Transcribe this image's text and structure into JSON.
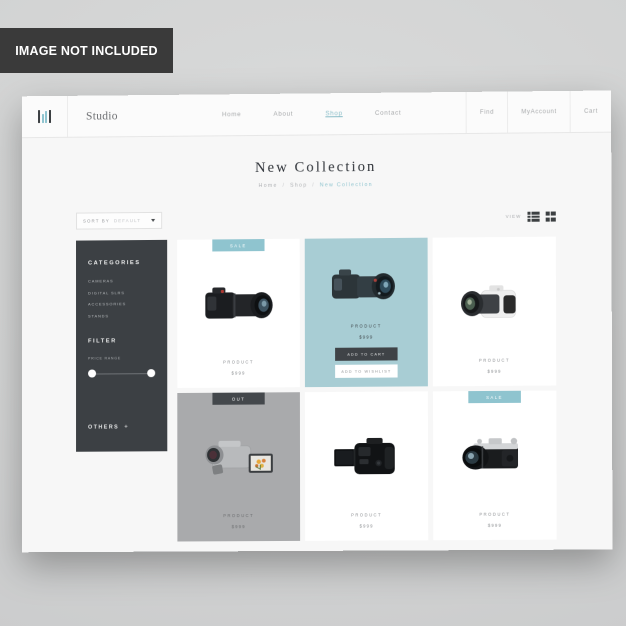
{
  "watermark": {
    "text": "IMAGE NOT INCLUDED"
  },
  "header": {
    "logo_icon": "bars-logo-icon",
    "brand": "Studio",
    "nav": [
      {
        "label": "Home",
        "active": false
      },
      {
        "label": "About",
        "active": false
      },
      {
        "label": "Shop",
        "active": true
      },
      {
        "label": "Contact",
        "active": false
      }
    ],
    "utility": [
      {
        "label": "Find"
      },
      {
        "label": "MyAccount"
      },
      {
        "label": "Cart"
      }
    ]
  },
  "page": {
    "title": "New Collection",
    "breadcrumb": {
      "first": "Home",
      "second": "Shop",
      "current": "New Collection",
      "separator": "/"
    }
  },
  "toolbar": {
    "sort_label": "SORT BY",
    "sort_value": "DEFAULT",
    "sort_caret_icon": "chevron-down-icon",
    "view_label": "VIEW",
    "list_view_icon": "list-view-icon",
    "grid_view_icon": "grid-view-icon"
  },
  "sidebar": {
    "categories_heading": "CATEGORIES",
    "categories": [
      "CAMERAS",
      "DIGITAL SLRS",
      "ACCESSORIES",
      "STANDS"
    ],
    "filter_heading": "FILTER",
    "price_range_label": "PRICE RANGE",
    "slider": {
      "min_handle": "slider-handle-min",
      "max_handle": "slider-handle-max"
    },
    "others_label": "OTHERS",
    "others_plus": "+"
  },
  "products": [
    {
      "badge": "SALE",
      "badge_type": "sale",
      "name": "PRODUCT",
      "price": "$999",
      "state": "default",
      "image": "black-dslr-camera"
    },
    {
      "badge": "",
      "badge_type": "none",
      "name": "PRODUCT",
      "price": "$999",
      "state": "hover",
      "image": "teal-dslr-camera",
      "cta_cart": "ADD TO CART",
      "cta_wishlist": "ADD TO WISHLIST"
    },
    {
      "badge": "",
      "badge_type": "none",
      "name": "PRODUCT",
      "price": "$999",
      "state": "default",
      "image": "white-dslr-camera"
    },
    {
      "badge": "OUT",
      "badge_type": "out",
      "name": "PRODUCT",
      "price": "$999",
      "state": "out",
      "image": "silver-camcorder"
    },
    {
      "badge": "",
      "badge_type": "none",
      "name": "PRODUCT",
      "price": "$999",
      "state": "default",
      "image": "black-dslr-flip-screen"
    },
    {
      "badge": "SALE",
      "badge_type": "sale",
      "name": "PRODUCT",
      "price": "$999",
      "state": "default",
      "image": "vintage-silver-slr"
    }
  ],
  "colors": {
    "accent_teal": "#8fc4cf",
    "dark": "#3c4044",
    "page_bg": "#f7f7f7",
    "backdrop": "#d5d6d6"
  }
}
